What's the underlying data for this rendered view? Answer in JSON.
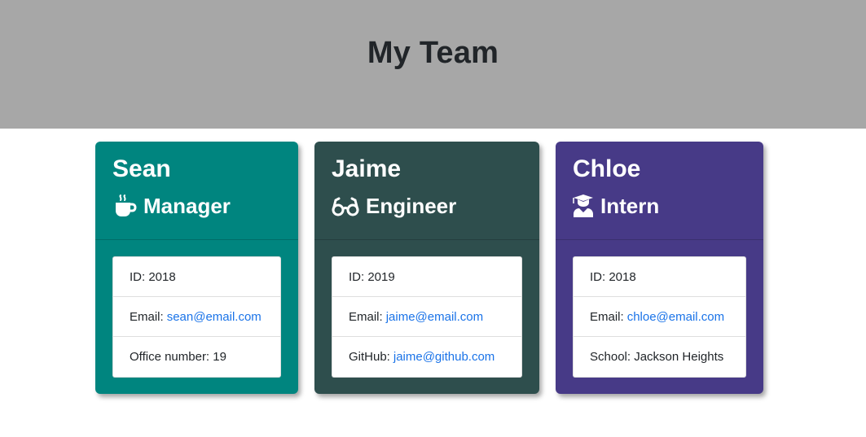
{
  "header": {
    "title": "My Team"
  },
  "colors": {
    "header_bg": "#a7a7a7",
    "manager": "#00857f",
    "engineer": "#2e4e4d",
    "intern": "#473a87",
    "link": "#1a73e8"
  },
  "cards": [
    {
      "name": "Sean",
      "role": "Manager",
      "role_icon": "coffee-mug-icon",
      "id_label": "ID: 2018",
      "email_label": "Email:",
      "email": "sean@email.com",
      "extra_label": "Office number: 19"
    },
    {
      "name": "Jaime",
      "role": "Engineer",
      "role_icon": "glasses-icon",
      "id_label": "ID: 2019",
      "email_label": "Email:",
      "email": "jaime@email.com",
      "extra_label": "GitHub:",
      "extra_link": "jaime@github.com"
    },
    {
      "name": "Chloe",
      "role": "Intern",
      "role_icon": "graduate-icon",
      "id_label": "ID: 2018",
      "email_label": "Email:",
      "email": "chloe@email.com",
      "extra_label": "School: Jackson Heights"
    }
  ]
}
